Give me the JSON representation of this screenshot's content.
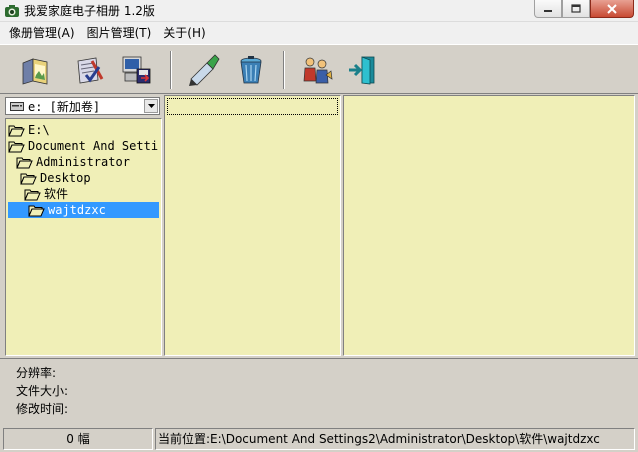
{
  "window": {
    "title": "我爱家庭电子相册 1.2版"
  },
  "menu": [
    {
      "label": "像册管理(A)"
    },
    {
      "label": "图片管理(T)"
    },
    {
      "label": "关于(H)"
    }
  ],
  "toolbar": {
    "buttons": [
      {
        "icon": "open-album-icon"
      },
      {
        "icon": "album-settings-icon"
      },
      {
        "icon": "computer-save-icon"
      },
      {
        "icon": "edit-pen-icon"
      },
      {
        "icon": "recycle-bin-icon"
      },
      {
        "icon": "people-icon"
      },
      {
        "icon": "exit-door-icon"
      }
    ]
  },
  "drive": {
    "selected": "e: [新加卷]"
  },
  "tree": [
    {
      "label": "E:\\",
      "level": 0,
      "selected": false
    },
    {
      "label": "Document And Setti",
      "level": 0,
      "selected": false
    },
    {
      "label": "Administrator",
      "level": 1,
      "selected": false
    },
    {
      "label": "Desktop",
      "level": 2,
      "selected": false
    },
    {
      "label": "软件",
      "level": 3,
      "selected": false
    },
    {
      "label": "wajtdzxc",
      "level": 4,
      "selected": true
    }
  ],
  "info": {
    "resolution_label": "分辨率:",
    "filesize_label": "文件大小:",
    "modified_label": "修改时间:"
  },
  "status": {
    "count": "0 幅",
    "location": "当前位置:E:\\Document And Settings2\\Administrator\\Desktop\\软件\\wajtdzxc"
  },
  "colors": {
    "panel_bg": "#f0efb7",
    "selection": "#3399ff",
    "chrome": "#d4d0c8"
  }
}
